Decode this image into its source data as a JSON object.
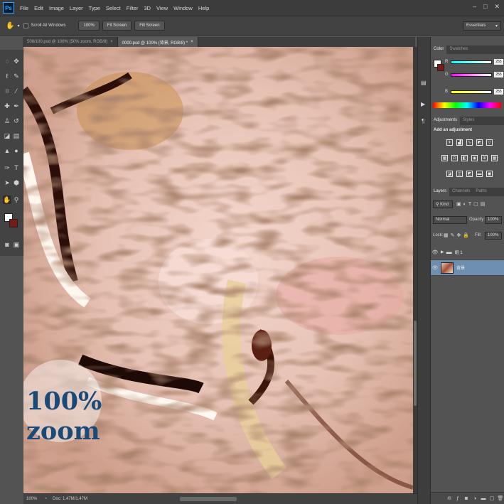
{
  "menubar": {
    "logo": "Ps",
    "items": [
      "File",
      "Edit",
      "Image",
      "Layer",
      "Type",
      "Select",
      "Filter",
      "3D",
      "View",
      "Window",
      "Help"
    ],
    "window_controls": [
      "–",
      "□",
      "✕"
    ]
  },
  "options": {
    "scroll_all_label": "Scroll All Windows",
    "btn_100": "100%",
    "btn_fit": "Fit Screen",
    "btn_fill": "Fill Screen",
    "workspace": "Essentials"
  },
  "tabs": [
    {
      "label": "508/100.psd @ 100% (50% zoom, RGB/8)",
      "active": false
    },
    {
      "label": "0000.psd @ 100% (背景, RGB/8) *",
      "active": true
    }
  ],
  "overlay": {
    "line1": "100%",
    "line2": "zoom"
  },
  "status": {
    "zoom": "100%",
    "doc": "Doc: 1.47M/1.47M"
  },
  "color_panel": {
    "tabs": [
      "Color",
      "Swatches"
    ],
    "channels": [
      {
        "name": "R",
        "value": "255"
      },
      {
        "name": "G",
        "value": "255"
      },
      {
        "name": "B",
        "value": "255"
      }
    ]
  },
  "adjust_panel": {
    "tabs": [
      "Adjustments",
      "Styles"
    ],
    "title": "Add an adjustment"
  },
  "layers_panel": {
    "tabs": [
      "Layers",
      "Channels",
      "Paths"
    ],
    "kind": "Kind",
    "blend": "Normal",
    "opacity_label": "Opacity:",
    "opacity": "100%",
    "lock_label": "Lock:",
    "fill_label": "Fill:",
    "fill": "100%",
    "layers": [
      {
        "name": "组 1",
        "type": "group"
      },
      {
        "name": "背景",
        "type": "image"
      }
    ]
  },
  "colors": {
    "fg": "#ffffff",
    "bg": "#7a1a17",
    "accent": "#1a4a78"
  }
}
